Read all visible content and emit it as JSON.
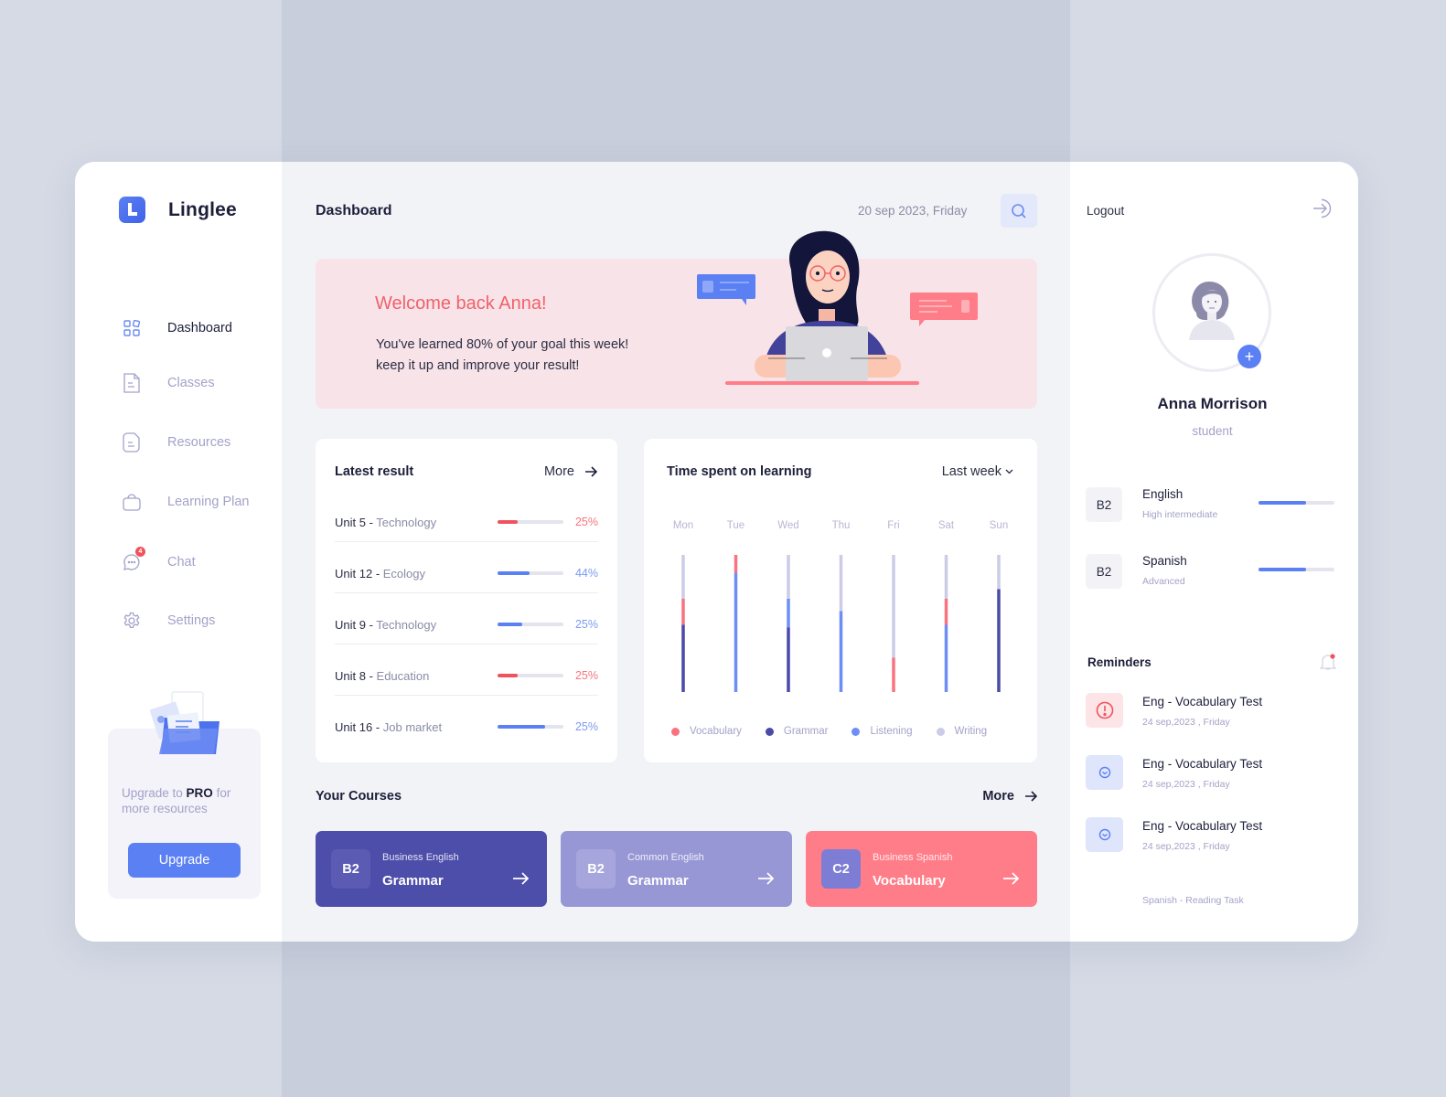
{
  "app": {
    "name": "Linglee"
  },
  "sidebar": {
    "items": [
      {
        "id": "dashboard",
        "label": "Dashboard",
        "icon": "grid-icon",
        "active": true
      },
      {
        "id": "classes",
        "label": "Classes",
        "icon": "document-icon",
        "active": false
      },
      {
        "id": "resources",
        "label": "Resources",
        "icon": "file-icon",
        "active": false
      },
      {
        "id": "learning-plan",
        "label": "Learning Plan",
        "icon": "bag-icon",
        "active": false
      },
      {
        "id": "chat",
        "label": "Chat",
        "icon": "chat-icon",
        "active": false,
        "badge": "4"
      },
      {
        "id": "settings",
        "label": "Settings",
        "icon": "gear-icon",
        "active": false
      }
    ],
    "promo": {
      "text_prefix": "Upgrade to ",
      "text_bold": "PRO",
      "text_suffix": " for more resources",
      "button_label": "Upgrade"
    }
  },
  "header": {
    "title": "Dashboard",
    "date": "20 sep 2023, Friday"
  },
  "hero": {
    "title": "Welcome back Anna!",
    "line1": "You've learned 80% of your goal this week!",
    "line2": "keep it up and improve your result!",
    "goal_progress_percent": 80
  },
  "latest_results": {
    "title": "Latest result",
    "more_label": "More",
    "items": [
      {
        "unit": "Unit 5",
        "topic": "Technology",
        "percent_label": "25%",
        "bar_fill": 0.3,
        "status": "low"
      },
      {
        "unit": "Unit 12",
        "topic": "Ecology",
        "percent_label": "44%",
        "bar_fill": 0.48,
        "status": "ok"
      },
      {
        "unit": "Unit 9",
        "topic": "Technology",
        "percent_label": "25%",
        "bar_fill": 0.37,
        "status": "ok"
      },
      {
        "unit": "Unit 8",
        "topic": "Education",
        "percent_label": "25%",
        "bar_fill": 0.3,
        "status": "low"
      },
      {
        "unit": "Unit 16",
        "topic": "Job market",
        "percent_label": "25%",
        "bar_fill": 0.72,
        "status": "ok"
      }
    ]
  },
  "time_spent": {
    "title": "Time spent on learning",
    "range_label": "Last week"
  },
  "chart_data": {
    "type": "bar",
    "title": "Time spent on learning",
    "stacked": true,
    "orientation": "vertical",
    "categories": [
      "Mon",
      "Tue",
      "Wed",
      "Thu",
      "Fri",
      "Sat",
      "Sun"
    ],
    "ylim": [
      0,
      100
    ],
    "unit": "percent of daily bar",
    "legend_position": "bottom",
    "series": [
      {
        "name": "Vocabulary",
        "color": "#f9737e",
        "values": [
          19,
          13,
          0,
          0,
          25,
          19,
          0
        ]
      },
      {
        "name": "Grammar",
        "color": "#4a4aa8",
        "values": [
          49,
          0,
          47,
          0,
          0,
          0,
          75
        ]
      },
      {
        "name": "Listening",
        "color": "#6d8ef5",
        "values": [
          0,
          87,
          21,
          59,
          0,
          49,
          0
        ]
      },
      {
        "name": "Writing",
        "color": "#cccbe8",
        "values": [
          32,
          0,
          32,
          41,
          75,
          32,
          25
        ]
      }
    ],
    "stack_order_bottom_to_top": [
      "Grammar",
      "Listening",
      "Vocabulary",
      "Writing"
    ]
  },
  "courses": {
    "title": "Your Courses",
    "more_label": "More",
    "items": [
      {
        "level": "B2",
        "category": "Business English",
        "title": "Grammar",
        "color": "#4d4daa",
        "level_bg": "#5b5bb4"
      },
      {
        "level": "B2",
        "category": "Common English",
        "title": "Grammar",
        "color": "#9797d6",
        "level_bg": "#a6a6dc"
      },
      {
        "level": "C2",
        "category": "Business Spanish",
        "title": "Vocabulary",
        "color": "#ff7d88",
        "level_bg": "#7d7dd6"
      }
    ]
  },
  "profile": {
    "logout_label": "Logout",
    "name": "Anna Morrison",
    "role": "student",
    "languages": [
      {
        "level": "B2",
        "name": "English",
        "description": "High intermediate",
        "progress": 0.63
      },
      {
        "level": "B2",
        "name": "Spanish",
        "description": "Advanced",
        "progress": 0.63
      }
    ]
  },
  "reminders": {
    "title": "Reminders",
    "has_unread": true,
    "items": [
      {
        "title": "Eng - Vocabulary Test",
        "date": "24 sep,2023 , Friday",
        "icon": "alert-icon",
        "type": "urgent"
      },
      {
        "title": "Eng - Vocabulary Test",
        "date": "24 sep,2023 , Friday",
        "icon": "clock-icon",
        "type": "normal"
      },
      {
        "title": "Eng - Vocabulary Test",
        "date": "24 sep,2023 , Friday",
        "icon": "clock-icon",
        "type": "normal"
      }
    ],
    "extra_item": "Spanish - Reading Task"
  },
  "colors": {
    "accent": "#5b80f3",
    "danger": "#f0535e",
    "muted_text": "#a3a2c9",
    "hero_bg": "#f8e4e8"
  }
}
